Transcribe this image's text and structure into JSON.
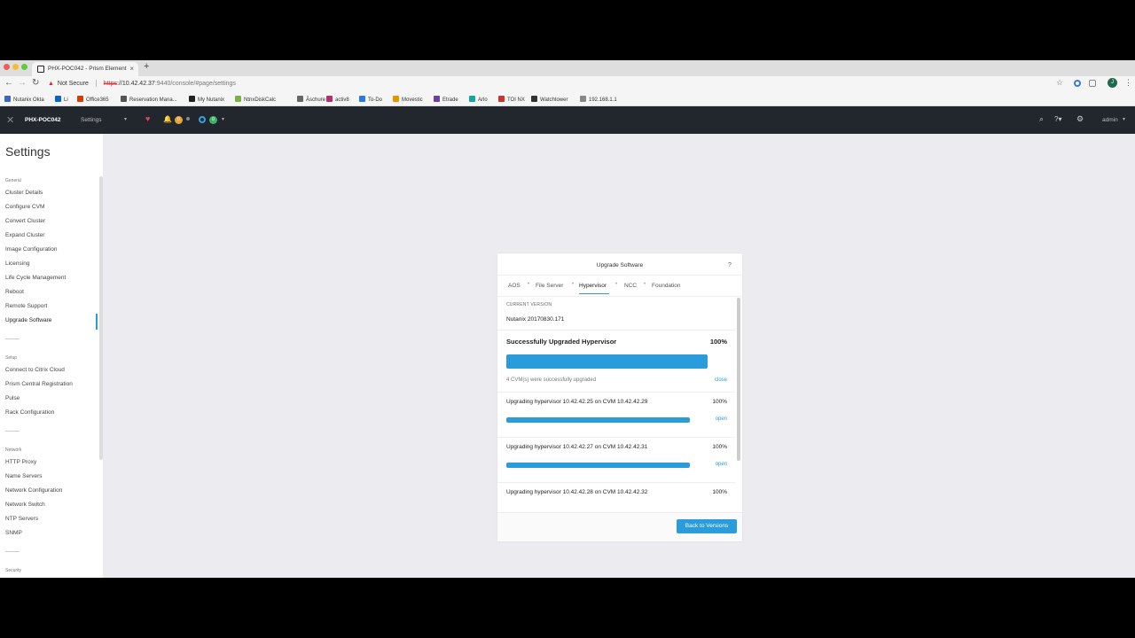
{
  "browser": {
    "tab_title": "PHX-POC042 - Prism Element",
    "tab_close": "×",
    "new_tab": "+",
    "security_label": "Not Secure",
    "url_scheme": "https",
    "url_host": "://10.42.42.37",
    "url_path": ":9440/console/#page/settings",
    "avatar_initial": "J",
    "bookmarks": [
      {
        "label": "Nutanix Okta",
        "color": "#3a66c4"
      },
      {
        "label": "Li",
        "color": "#0a66c2"
      },
      {
        "label": "Office365",
        "color": "#d83b01"
      },
      {
        "label": "Reservation Mana...",
        "color": "#555555"
      },
      {
        "label": "My Nutanix",
        "color": "#222222"
      },
      {
        "label": "NtnxDiskCalc",
        "color": "#7bb342"
      },
      {
        "label": "Āschure",
        "color": "#666666"
      },
      {
        "label": "activ8",
        "color": "#b0306a"
      },
      {
        "label": "To-Do",
        "color": "#2b78e4"
      },
      {
        "label": "Movestic",
        "color": "#e69500"
      },
      {
        "label": "Etrade",
        "color": "#6a3fa0"
      },
      {
        "label": "Arlo",
        "color": "#13a89e"
      },
      {
        "label": "TOI NX",
        "color": "#cc3333"
      },
      {
        "label": "Watchtower",
        "color": "#333333"
      },
      {
        "label": "192.168.1.1",
        "color": "#888888"
      }
    ]
  },
  "header": {
    "cluster_name": "PHX-POC042",
    "menu_label": "Settings",
    "alerts_count": "0",
    "tasks_count": "0",
    "user_label": "admin"
  },
  "sidebar": {
    "title": "Settings",
    "sections": [
      {
        "title": "General",
        "items": [
          "Cluster Details",
          "Configure CVM",
          "Convert Cluster",
          "Expand Cluster",
          "Image Configuration",
          "Licensing",
          "Life Cycle Management",
          "Reboot",
          "Remote Support",
          "Upgrade Software"
        ]
      },
      {
        "title": "Setup",
        "items": [
          "Connect to Citrix Cloud",
          "Prism Central Registration",
          "Pulse",
          "Rack Configuration"
        ]
      },
      {
        "title": "Network",
        "items": [
          "HTTP Proxy",
          "Name Servers",
          "Network Configuration",
          "Network Switch",
          "NTP Servers",
          "SNMP"
        ]
      },
      {
        "title": "Security",
        "items": []
      }
    ],
    "active_item": "Upgrade Software"
  },
  "modal": {
    "title": "Upgrade Software",
    "help": "?",
    "tabs": [
      "AOS",
      "File Server",
      "Hypervisor",
      "NCC",
      "Foundation"
    ],
    "active_tab": "Hypervisor",
    "current_version_label": "CURRENT VERSION",
    "current_version": "Nutanix 20170830.171",
    "summary": {
      "title": "Successfully Upgraded Hypervisor",
      "percent": "100%",
      "progress": 1.0,
      "message": "4 CVM(s) were successfully upgraded",
      "action": "close"
    },
    "upgrades": [
      {
        "label": "Upgrading hypervisor 10.42.42.25 on CVM 10.42.42.29",
        "percent": "100%",
        "progress": 1.0,
        "action": "open"
      },
      {
        "label": "Upgrading hypervisor 10.42.42.27 on CVM 10.42.42.31",
        "percent": "100%",
        "progress": 1.0,
        "action": "open"
      },
      {
        "label": "Upgrading hypervisor 10.42.42.28 on CVM 10.42.42.32",
        "percent": "100%",
        "progress": 1.0,
        "action": ""
      }
    ],
    "back_button": "Back to Versions"
  },
  "colors": {
    "accent": "#2a9bdb",
    "header_bg": "#22272e",
    "page_bg": "#ececf0"
  }
}
